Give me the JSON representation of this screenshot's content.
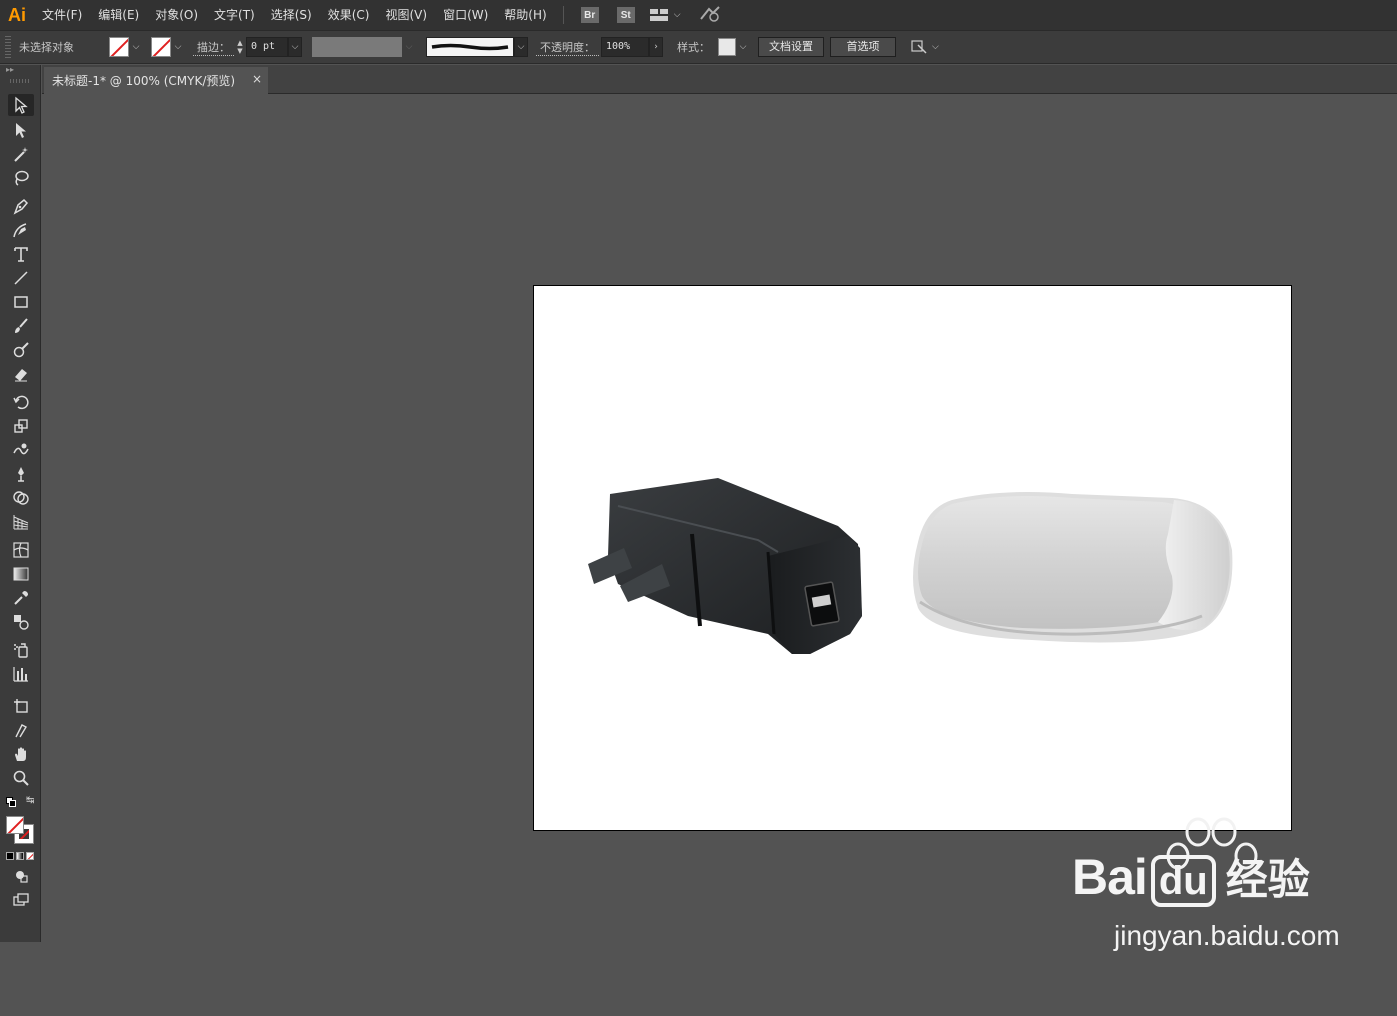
{
  "app": {
    "logo": "Ai",
    "accent": "#ff9a00"
  },
  "menu": {
    "items": [
      {
        "label": "文件(F)"
      },
      {
        "label": "编辑(E)"
      },
      {
        "label": "对象(O)"
      },
      {
        "label": "文字(T)"
      },
      {
        "label": "选择(S)"
      },
      {
        "label": "效果(C)"
      },
      {
        "label": "视图(V)"
      },
      {
        "label": "窗口(W)"
      },
      {
        "label": "帮助(H)"
      }
    ],
    "bridge": "Br",
    "stock": "St"
  },
  "control": {
    "selection_status": "未选择对象",
    "stroke_label": "描边：",
    "stroke_value": "0 pt",
    "opacity_label": "不透明度：",
    "opacity_value": "100%",
    "style_label": "样式：",
    "doc_setup": "文档设置",
    "preferences": "首选项"
  },
  "document": {
    "tab_title": "未标题-1* @ 100% (CMYK/预览)",
    "close": "×"
  },
  "tools": [
    "selection-tool-icon",
    "direct-selection-tool-icon",
    "magic-wand-tool-icon",
    "lasso-tool-icon",
    "pen-tool-icon",
    "curvature-tool-icon",
    "type-tool-icon",
    "line-tool-icon",
    "rectangle-tool-icon",
    "paintbrush-tool-icon",
    "shaper-tool-icon",
    "eraser-tool-icon",
    "rotate-tool-icon",
    "scale-tool-icon",
    "warp-tool-icon",
    "puppet-warp-tool-icon",
    "shape-builder-tool-icon",
    "perspective-grid-tool-icon",
    "mesh-tool-icon",
    "gradient-tool-icon",
    "eyedropper-tool-icon",
    "blend-tool-icon",
    "symbol-sprayer-tool-icon",
    "column-graph-tool-icon",
    "artboard-tool-icon",
    "slice-tool-icon",
    "hand-tool-icon",
    "zoom-tool-icon"
  ],
  "watermark": {
    "brand_text": "Bai",
    "brand_du": "du",
    "cn": "经验",
    "url": "jingyan.baidu.com"
  }
}
